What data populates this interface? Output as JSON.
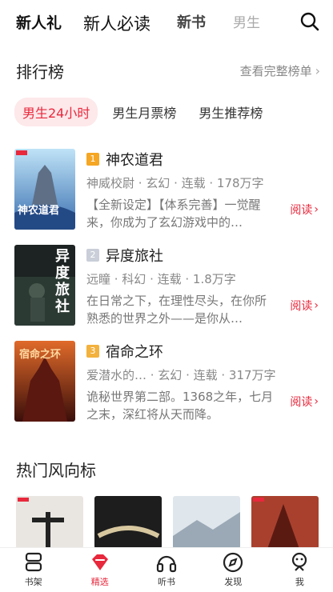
{
  "topnav": {
    "tabs": [
      "新人礼",
      "新人必读",
      "新书",
      "男生"
    ],
    "active_index": 1
  },
  "ranking": {
    "title": "排行榜",
    "more": "查看完整榜单"
  },
  "chips": [
    {
      "label": "男生24小时",
      "active": true
    },
    {
      "label": "男生月票榜",
      "active": false
    },
    {
      "label": "男生推荐榜",
      "active": false
    }
  ],
  "books": [
    {
      "rank": "1",
      "title": "神农道君",
      "meta": "神威校尉 · 玄幻 · 连载 · 178万字",
      "desc": "【全新设定】【体系完善】一觉醒来，你成为了玄幻游戏中的…",
      "read": "阅读",
      "cover_text": "神农道君"
    },
    {
      "rank": "2",
      "title": "异度旅社",
      "meta": "远瞳 · 科幻 · 连载 · 1.8万字",
      "desc": "在日常之下，在理性尽头，在你所熟悉的世界之外——是你从…",
      "read": "阅读",
      "cover_text": "异度旅社"
    },
    {
      "rank": "3",
      "title": "宿命之环",
      "meta": "爱潜水的…   · 玄幻 · 连载 · 317万字",
      "desc": "诡秘世界第二部。1368之年，七月之末，深红将从天而降。",
      "read": "阅读",
      "cover_text": "宿命之环"
    }
  ],
  "hot": {
    "title": "热门风向标"
  },
  "tabbar": [
    {
      "label": "书架",
      "icon": "bookshelf-icon"
    },
    {
      "label": "精选",
      "icon": "gem-icon",
      "active": true
    },
    {
      "label": "听书",
      "icon": "headphones-icon"
    },
    {
      "label": "发现",
      "icon": "compass-icon"
    },
    {
      "label": "我",
      "icon": "profile-icon"
    }
  ],
  "colors": {
    "accent": "#e8283c",
    "chip_bg": "#fde8ea",
    "rank1": "#f5a623",
    "rank2": "#c9ced8",
    "rank3": "#f3b13d"
  }
}
